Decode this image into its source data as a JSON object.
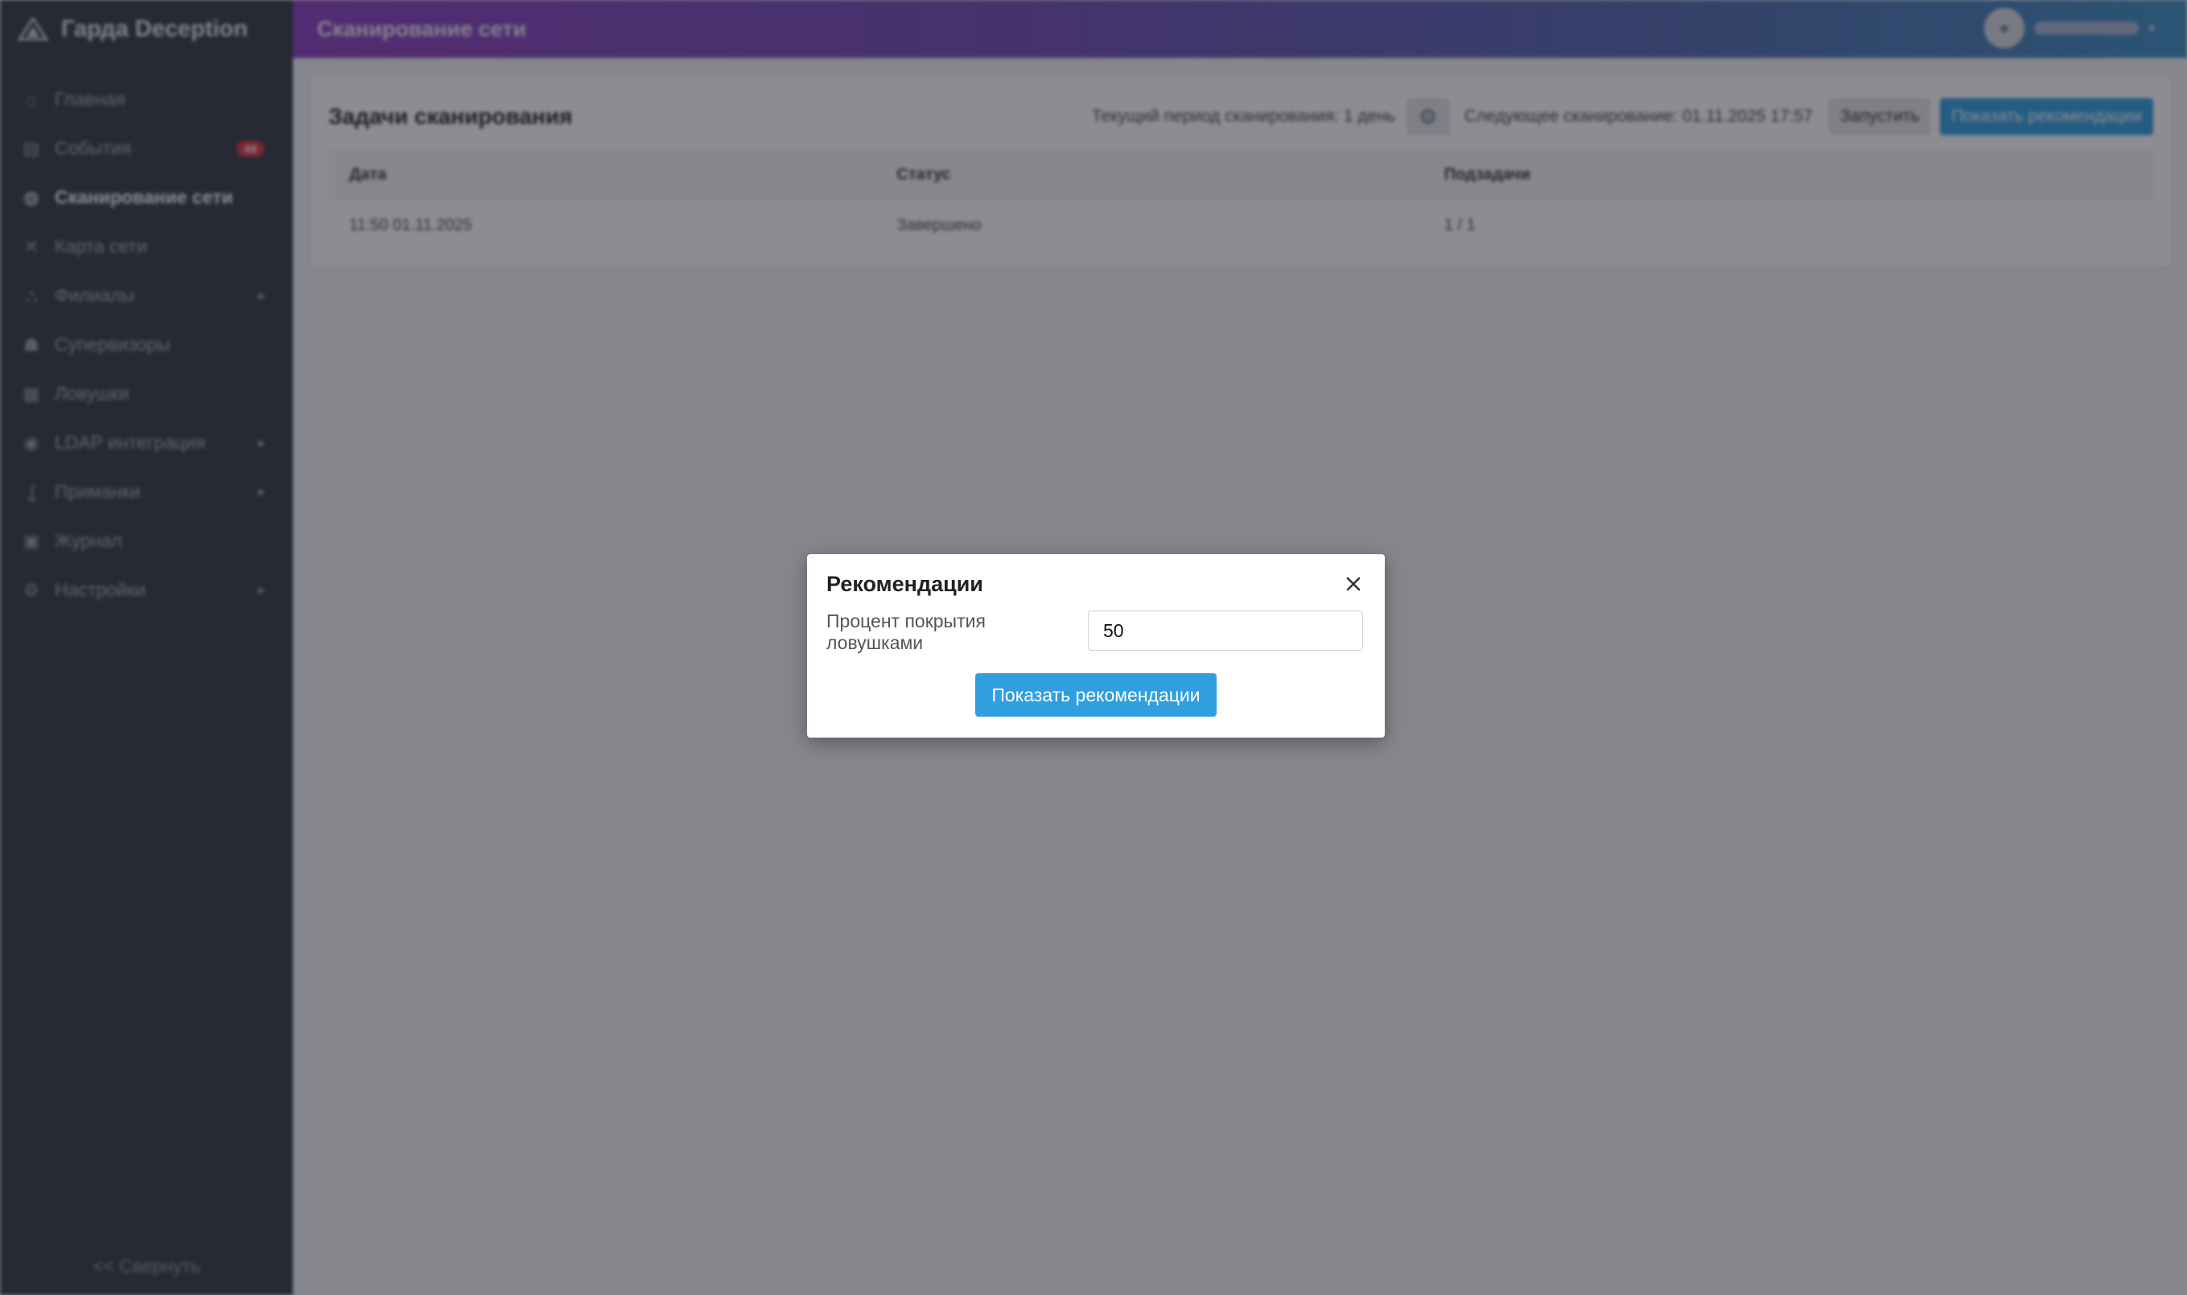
{
  "app": {
    "brand": "Гарда Deception",
    "page_title": "Сканирование сети",
    "collapse_label": "<< Свернуть"
  },
  "sidebar": {
    "items": [
      {
        "label": "Главная",
        "icon": "home-icon"
      },
      {
        "label": "События",
        "icon": "events-icon",
        "badge": "49"
      },
      {
        "label": "Сканирование сети",
        "icon": "scan-icon",
        "active": true
      },
      {
        "label": "Карта сети",
        "icon": "network-map-icon"
      },
      {
        "label": "Филиалы",
        "icon": "branches-icon",
        "has_submenu": true
      },
      {
        "label": "Супервизоры",
        "icon": "supervisors-icon"
      },
      {
        "label": "Ловушки",
        "icon": "traps-icon"
      },
      {
        "label": "LDAP интеграция",
        "icon": "ldap-icon",
        "has_submenu": true
      },
      {
        "label": "Приманки",
        "icon": "baits-icon",
        "has_submenu": true
      },
      {
        "label": "Журнал",
        "icon": "journal-icon"
      },
      {
        "label": "Настройки",
        "icon": "settings-icon",
        "has_submenu": true
      }
    ]
  },
  "card": {
    "title": "Задачи сканирования",
    "period_text": "Текущий период сканирования: 1 день",
    "next_scan_text": "Следующее сканирование: 01.11.2025 17:57",
    "run_label": "Запустить",
    "show_rec_label": "Показать рекомендации",
    "table": {
      "columns": [
        "Дата",
        "Статус",
        "Подзадачи"
      ],
      "rows": [
        [
          "11:50 01.11.2025",
          "Завершено",
          "1 / 1"
        ]
      ]
    }
  },
  "modal": {
    "title": "Рекомендации",
    "field_label": "Процент покрытия ловушками",
    "field_value": "50",
    "submit_label": "Показать рекомендации"
  },
  "colors": {
    "accent": "#2f9fe0",
    "sidebar_bg": "#343a45",
    "badge": "#dc3545"
  }
}
